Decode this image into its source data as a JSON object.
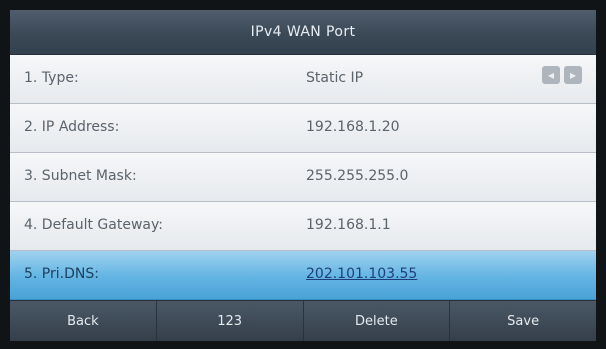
{
  "title": "IPv4 WAN Port",
  "fields": [
    {
      "label": "1. Type:",
      "value": "Static IP"
    },
    {
      "label": "2. IP Address:",
      "value": "192.168.1.20"
    },
    {
      "label": "3. Subnet Mask:",
      "value": "255.255.255.0"
    },
    {
      "label": "4. Default Gateway:",
      "value": "192.168.1.1"
    },
    {
      "label": "5. Pri.DNS:",
      "value": "202.101.103.55"
    }
  ],
  "type_arrows": {
    "left": "◂",
    "right": "▸"
  },
  "softkeys": [
    "Back",
    "123",
    "Delete",
    "Save"
  ],
  "colors": {
    "selected_row": "#62b4e3",
    "titlebar": "#3b4957",
    "softkey_bar": "#353f4a"
  }
}
